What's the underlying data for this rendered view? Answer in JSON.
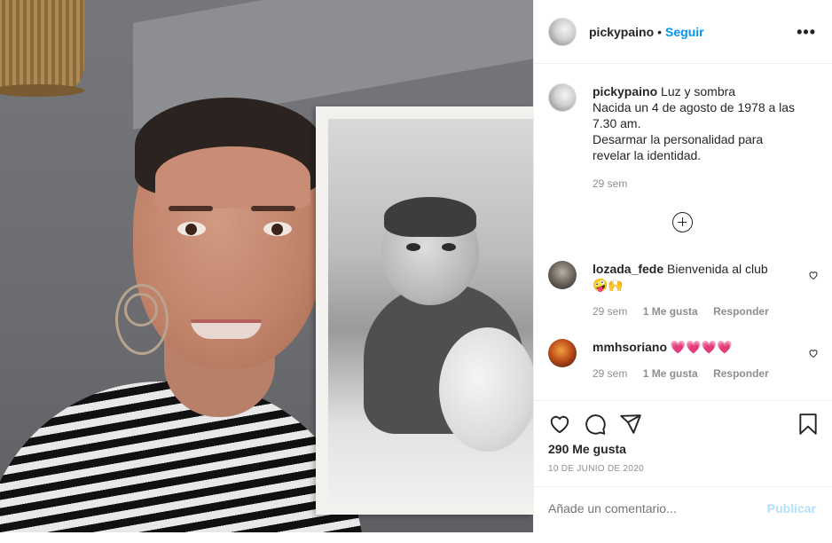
{
  "post": {
    "username": "pickypaino",
    "follow_label": "Seguir",
    "more_label": "•••"
  },
  "caption": {
    "username": "pickypaino",
    "lines": [
      "Luz y sombra",
      "Nacida un 4 de agosto de 1978 a las",
      "7.30 am.",
      "Desarmar la personalidad para",
      "revelar la identidad."
    ],
    "time": "29 sem"
  },
  "comments": [
    {
      "username": "lozada_fede",
      "text": "Bienvenida al club",
      "emoji": "🤪🙌",
      "time": "29 sem",
      "likes": "1 Me gusta",
      "reply": "Responder"
    },
    {
      "username": "mmhsoriano",
      "text": "",
      "emoji": "💗💗💗💗",
      "time": "29 sem",
      "likes": "1 Me gusta",
      "reply": "Responder"
    }
  ],
  "footer": {
    "likes_text": "290 Me gusta",
    "date": "10 DE JUNIO DE 2020",
    "comment_placeholder": "Añade un comentario...",
    "publish_label": "Publicar"
  },
  "icons": [
    "heart-icon",
    "comment-icon",
    "share-icon",
    "bookmark-icon",
    "add-comments-icon",
    "more-options-icon"
  ],
  "colors": {
    "link": "#0095f6",
    "muted": "#8e8e8e",
    "publish_disabled": "#b2dffc"
  }
}
